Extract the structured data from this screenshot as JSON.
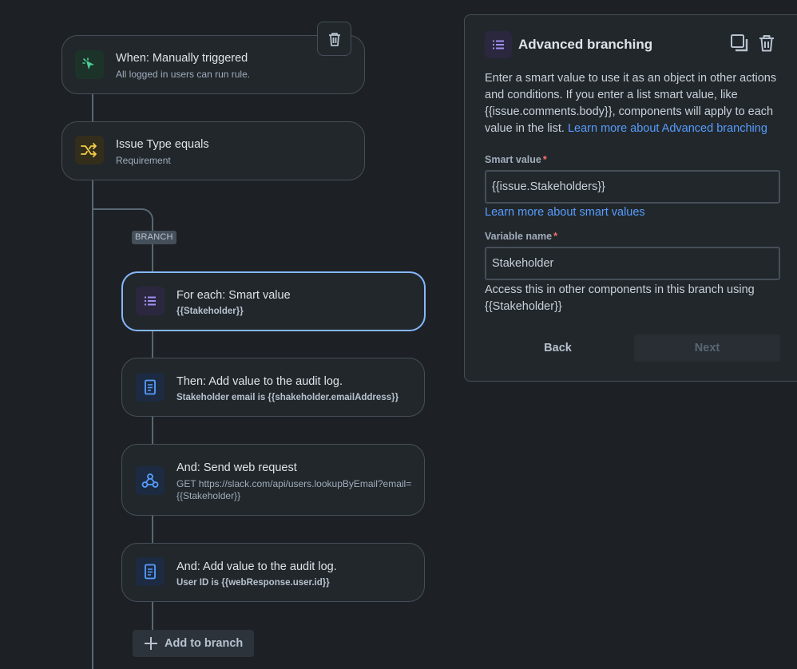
{
  "flow": {
    "trigger": {
      "title": "When: Manually triggered",
      "subtitle": "All logged in users can run rule."
    },
    "condition": {
      "title": "Issue Type equals",
      "subtitle": "Requirement"
    },
    "branch_label": "BRANCH",
    "branch": {
      "title": "For each: Smart value",
      "subtitle": "{{Stakeholder}}"
    },
    "actions": [
      {
        "title": "Then: Add value to the audit log.",
        "subtitle": "Stakeholder email is {{shakeholder.emailAddress}}"
      },
      {
        "title": "And: Send web request",
        "subtitle_line1": "GET https://slack.com/api/users.lookupByEmail?email=",
        "subtitle_line2": "{{Stakeholder}}"
      },
      {
        "title": "And: Add value to the audit log.",
        "subtitle": "User ID is {{webResponse.user.id}}"
      }
    ],
    "add_to_branch_label": "Add to branch"
  },
  "panel": {
    "title": "Advanced branching",
    "description": "Enter a smart value to use it as an object in other actions and conditions. If you enter a list smart value, like {{issue.comments.body}}, components will apply to each value in the list.",
    "description_link": "Learn more about Advanced branching",
    "smart_value_label": "Smart value",
    "smart_value": "{{issue.Stakeholders}}",
    "smart_values_link": "Learn more about smart values",
    "variable_name_label": "Variable name",
    "variable_name": "Stakeholder",
    "required_marker": "*",
    "hint": "Access this in other components in this branch using {{Stakeholder}}",
    "back_label": "Back",
    "next_label": "Next"
  },
  "colors": {
    "background": "#1d2125",
    "accent_link": "#579dff",
    "selected_border": "#85b8ff",
    "required": "#f87168"
  }
}
